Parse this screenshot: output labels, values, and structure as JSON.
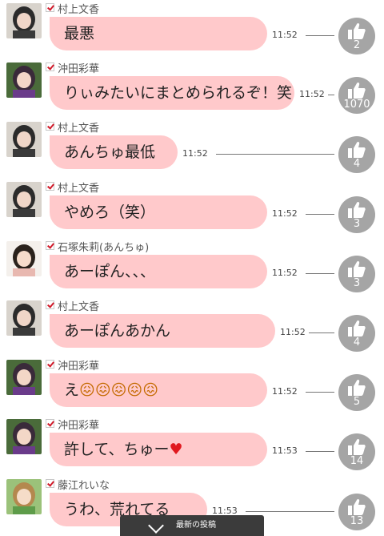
{
  "messages": [
    {
      "name": "村上文香",
      "text": "最悪",
      "time": "11:52",
      "likes": "2",
      "avatar": "girl-tie"
    },
    {
      "name": "沖田彩華",
      "text": "りぃみたいにまとめられるぞ！笑",
      "time": "11:52",
      "likes": "1070",
      "avatar": "girl-purple"
    },
    {
      "name": "村上文香",
      "text": "あんちゅ最低",
      "time": "11:52",
      "likes": "4",
      "avatar": "girl-tie"
    },
    {
      "name": "村上文香",
      "text": "やめろ（笑）",
      "time": "11:52",
      "likes": "3",
      "avatar": "girl-tie"
    },
    {
      "name": "石塚朱莉(あんちゅ)",
      "text": "あーぽん、、、",
      "time": "11:52",
      "likes": "3",
      "avatar": "girl-hands"
    },
    {
      "name": "村上文香",
      "text": "あーぽんあかん",
      "time": "11:52",
      "likes": "4",
      "avatar": "girl-tie"
    },
    {
      "name": "沖田彩華",
      "text": "え",
      "emoji": "😖😖😖😖😖",
      "time": "11:52",
      "likes": "5",
      "avatar": "girl-purple"
    },
    {
      "name": "沖田彩華",
      "text": "許して、ちゅー",
      "emoji": "♥",
      "time": "11:53",
      "likes": "14",
      "avatar": "girl-purple"
    },
    {
      "name": "藤江れいな",
      "text": "うわ、荒れてる",
      "time": "11:53",
      "likes": "13",
      "avatar": "girl-green"
    }
  ],
  "footer": {
    "label": "最新の投稿"
  },
  "colors": {
    "bubble": "#ffc9cb",
    "like": "#a5a5a5",
    "check": "#d11a2a"
  }
}
